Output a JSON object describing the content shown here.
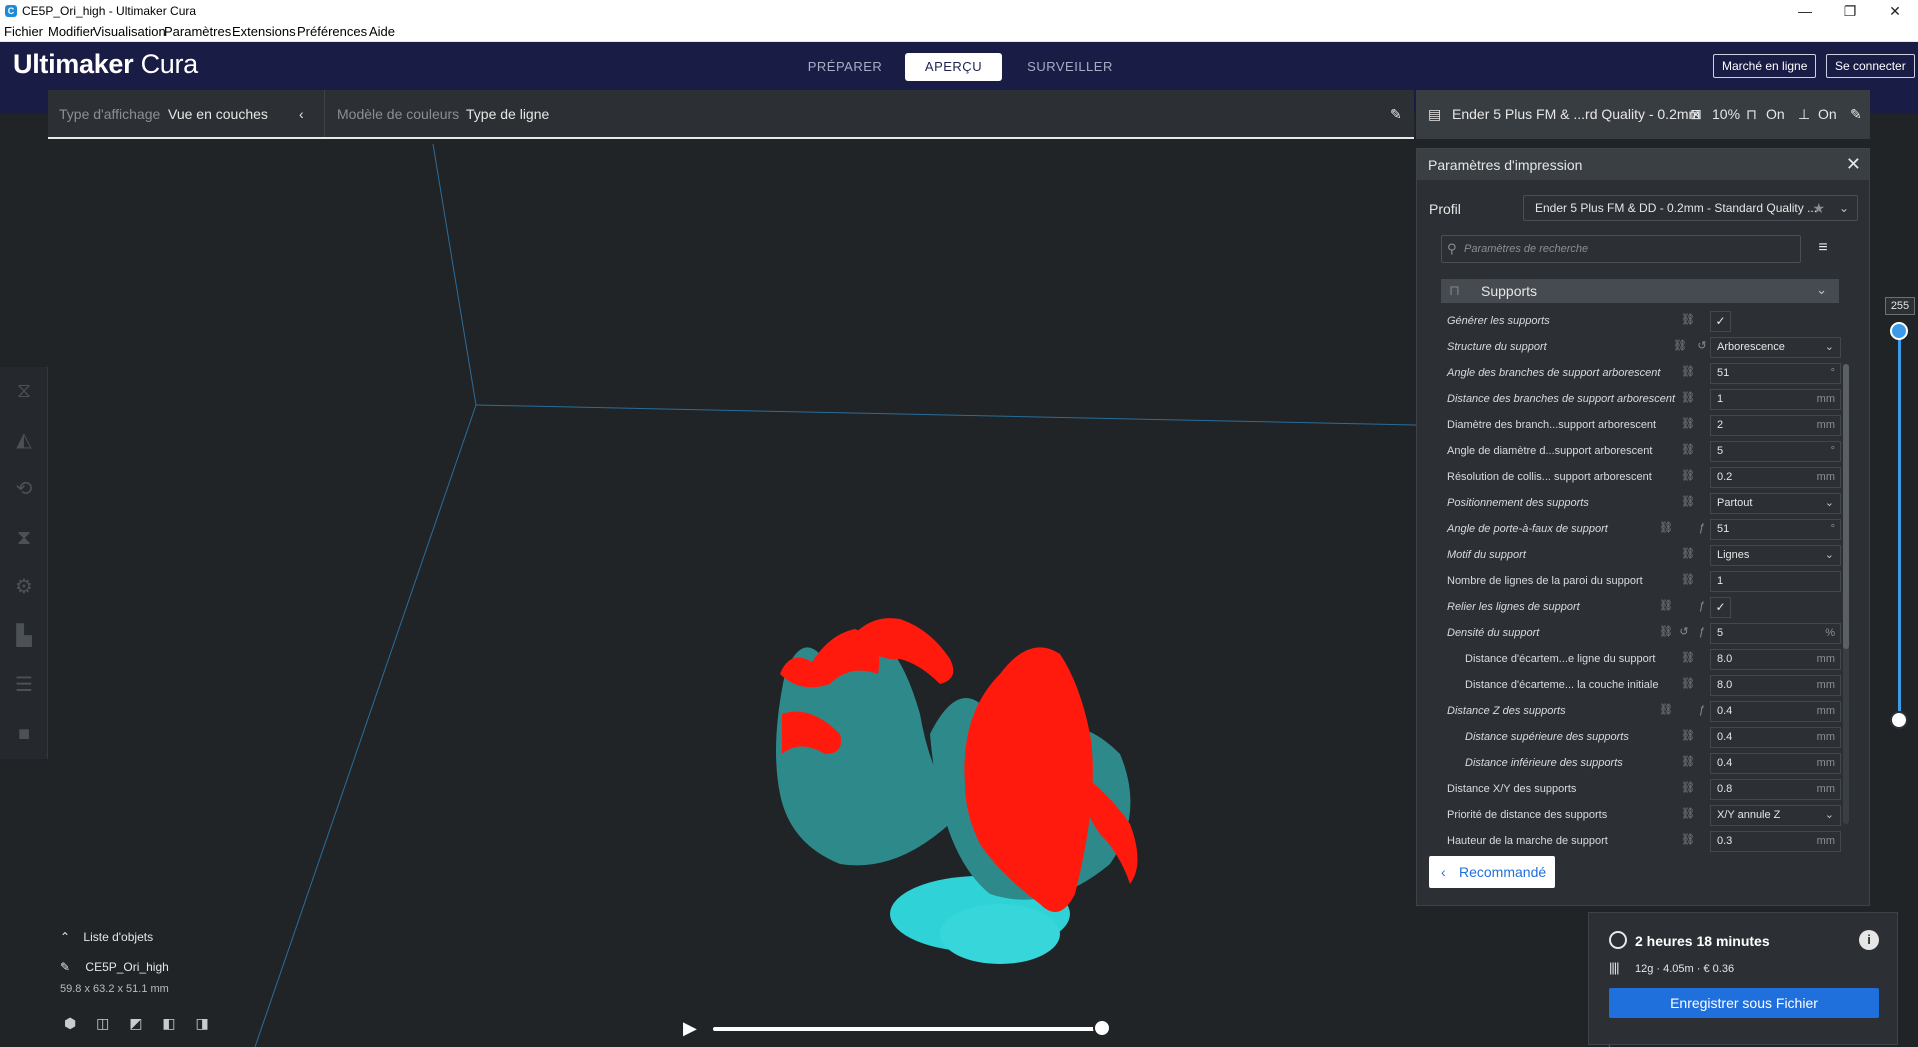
{
  "window": {
    "title": "CE5P_Ori_high - Ultimaker Cura",
    "app_icon": "cura-icon",
    "controls": [
      "minimize",
      "maximize",
      "close"
    ]
  },
  "menu": [
    "Fichier",
    "Modifier",
    "Visualisation",
    "Paramètres",
    "Extensions",
    "Préférences",
    "Aide"
  ],
  "brand": {
    "bold": "Ultimaker",
    "light": "Cura"
  },
  "stages": [
    {
      "label": "PRÉPARER",
      "active": false
    },
    {
      "label": "APERÇU",
      "active": true
    },
    {
      "label": "SURVEILLER",
      "active": false
    }
  ],
  "header_buttons": {
    "marketplace": "Marché en ligne",
    "signin": "Se connecter"
  },
  "viewbar": {
    "view_type_label": "Type d'affichage",
    "view_type_value": "Vue en couches",
    "color_scheme_label": "Modèle de couleurs",
    "color_scheme_value": "Type de ligne"
  },
  "printbar": {
    "profile": "Ender 5 Plus FM & ...rd Quality - 0.2mm",
    "infill": "10%",
    "support": "On",
    "adhesion": "On"
  },
  "settings_panel": {
    "title": "Paramètres d'impression",
    "profile_label": "Profil",
    "profile_value": "Ender 5 Plus FM & DD - 0.2mm - Standard Quality ...",
    "search_placeholder": "Paramètres de recherche",
    "category": "Supports",
    "recommended_button": "Recommandé",
    "rows": [
      {
        "name": "Générer les supports",
        "italic": true,
        "type": "check",
        "value": "✓"
      },
      {
        "name": "Structure du support",
        "italic": true,
        "type": "select",
        "value": "Arborescence",
        "reset": true
      },
      {
        "name": "Angle des branches de support arborescent",
        "italic": true,
        "type": "number",
        "value": "51",
        "unit": "°"
      },
      {
        "name": "Distance des branches de support arborescent",
        "italic": true,
        "type": "number",
        "value": "1",
        "unit": "mm"
      },
      {
        "name": "Diamètre des branch...support arborescent",
        "italic": false,
        "type": "number",
        "value": "2",
        "unit": "mm"
      },
      {
        "name": "Angle de diamètre d...support arborescent",
        "italic": false,
        "type": "number",
        "value": "5",
        "unit": "°"
      },
      {
        "name": "Résolution de collis... support arborescent",
        "italic": false,
        "type": "number",
        "value": "0.2",
        "unit": "mm"
      },
      {
        "name": "Positionnement des supports",
        "italic": true,
        "type": "select",
        "value": "Partout"
      },
      {
        "name": "Angle de porte-à-faux de support",
        "italic": true,
        "type": "number",
        "value": "51",
        "unit": "°",
        "formula": true
      },
      {
        "name": "Motif du support",
        "italic": true,
        "type": "select",
        "value": "Lignes"
      },
      {
        "name": "Nombre de lignes de la paroi du support",
        "italic": false,
        "type": "number",
        "value": "1",
        "unit": ""
      },
      {
        "name": "Relier les lignes de support",
        "italic": true,
        "type": "check",
        "value": "✓",
        "formula": true
      },
      {
        "name": "Densité du support",
        "italic": true,
        "type": "number",
        "value": "5",
        "unit": "%",
        "reset": true,
        "formula": true
      },
      {
        "name": "Distance d'écartem...e ligne du support",
        "italic": false,
        "type": "number",
        "value": "8.0",
        "unit": "mm",
        "indent": true
      },
      {
        "name": "Distance d'écarteme... la couche initiale",
        "italic": false,
        "type": "number",
        "value": "8.0",
        "unit": "mm",
        "indent": true
      },
      {
        "name": "Distance Z des supports",
        "italic": true,
        "type": "number",
        "value": "0.4",
        "unit": "mm",
        "formula": true
      },
      {
        "name": "Distance supérieure des supports",
        "italic": true,
        "type": "number",
        "value": "0.4",
        "unit": "mm",
        "indent": true
      },
      {
        "name": "Distance inférieure des supports",
        "italic": true,
        "type": "number",
        "value": "0.4",
        "unit": "mm",
        "indent": true
      },
      {
        "name": "Distance X/Y des supports",
        "italic": false,
        "type": "number",
        "value": "0.8",
        "unit": "mm"
      },
      {
        "name": "Priorité de distance des supports",
        "italic": false,
        "type": "select",
        "value": "X/Y annule Z"
      },
      {
        "name": "Hauteur de la marche de support",
        "italic": false,
        "type": "number",
        "value": "0.3",
        "unit": "mm"
      }
    ]
  },
  "layer_slider": {
    "max_label": "255"
  },
  "object_list": {
    "title": "Liste d'objets",
    "object_name": "CE5P_Ori_high",
    "dimensions": "59.8 x 63.2 x 51.1 mm"
  },
  "output": {
    "time": "2 heures 18 minutes",
    "stats": "12g · 4.05m · € 0.36",
    "save_button": "Enregistrer sous Fichier"
  },
  "colors": {
    "header_bg": "#191c45",
    "viewport_bg": "#202427",
    "panel_bg": "#2c3034",
    "accent_blue": "#1f6fdd",
    "model_red": "#ff1a0d",
    "model_teal": "#2e8a8a",
    "model_cyan": "#2fd2d6"
  }
}
